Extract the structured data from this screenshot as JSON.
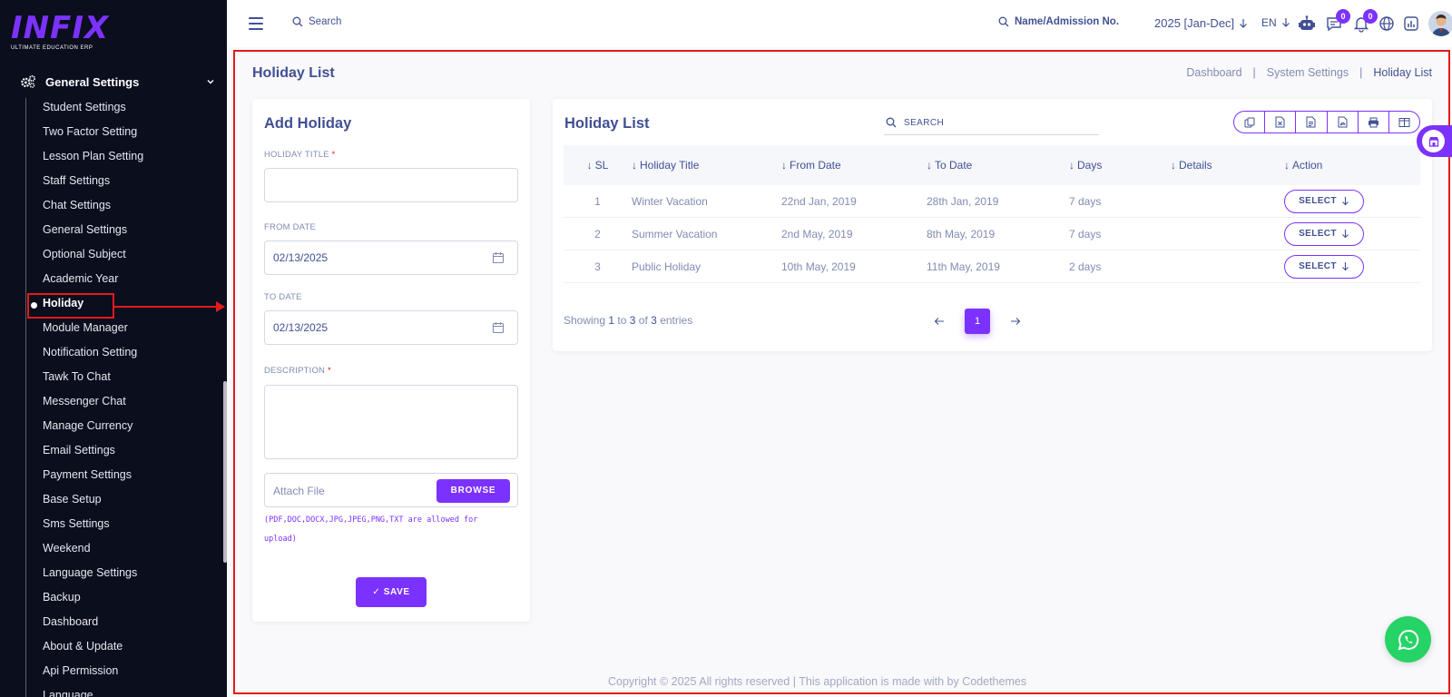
{
  "brand": {
    "logo_text": "INFIX",
    "logo_subtitle": "ULTIMATE EDUCATION ERP",
    "accent": "#7c32ff"
  },
  "sidebar": {
    "group_label": "General Settings",
    "items": [
      "Student Settings",
      "Two Factor Setting",
      "Lesson Plan Setting",
      "Staff Settings",
      "Chat Settings",
      "General Settings",
      "Optional Subject",
      "Academic Year",
      "Holiday",
      "Module Manager",
      "Notification Setting",
      "Tawk To Chat",
      "Messenger Chat",
      "Manage Currency",
      "Email Settings",
      "Payment Settings",
      "Base Setup",
      "Sms Settings",
      "Weekend",
      "Language Settings",
      "Backup",
      "Dashboard",
      "About & Update",
      "Api Permission",
      "Language"
    ],
    "active_item": "Holiday"
  },
  "header": {
    "search_placeholder": "Search",
    "admission_search": "Name/Admission No.",
    "year": "2025 [Jan-Dec]",
    "language": "EN",
    "chat_badge": "0",
    "notification_badge": "0"
  },
  "page": {
    "title": "Holiday List",
    "breadcrumb": [
      "Dashboard",
      "System Settings",
      "Holiday List"
    ]
  },
  "add_form": {
    "title": "Add Holiday",
    "holiday_title_label": "HOLIDAY TITLE",
    "required_mark": "*",
    "holiday_title_value": "",
    "from_date_label": "FROM DATE",
    "from_date_value": "02/13/2025",
    "to_date_label": "TO DATE",
    "to_date_value": "02/13/2025",
    "description_label": "DESCRIPTION",
    "attach_placeholder": "Attach File",
    "browse_label": "BROWSE",
    "allowed_note": "(PDF,DOC,DOCX,JPG,JPEG,PNG,TXT are allowed for upload)",
    "save_label": "SAVE"
  },
  "list": {
    "title": "Holiday List",
    "search_placeholder": "SEARCH",
    "columns": [
      "SL",
      "Holiday Title",
      "From Date",
      "To Date",
      "Days",
      "Details",
      "Action"
    ],
    "rows": [
      {
        "sl": "1",
        "title": "Winter Vacation",
        "from": "22nd Jan, 2019",
        "to": "28th Jan, 2019",
        "days": "7 days",
        "details": "",
        "action": "SELECT"
      },
      {
        "sl": "2",
        "title": "Summer Vacation",
        "from": "2nd May, 2019",
        "to": "8th May, 2019",
        "days": "7 days",
        "details": "",
        "action": "SELECT"
      },
      {
        "sl": "3",
        "title": "Public Holiday",
        "from": "10th May, 2019",
        "to": "11th May, 2019",
        "days": "2 days",
        "details": "",
        "action": "SELECT"
      }
    ],
    "showing_prefix": "Showing",
    "showing_from": "1",
    "showing_to_word": "to",
    "showing_to": "3",
    "showing_of_word": "of",
    "showing_total": "3",
    "showing_suffix": "entries",
    "current_page": "1"
  },
  "footer": {
    "text": "Copyright © 2025 All rights reserved | This application is made with by Codethemes"
  }
}
